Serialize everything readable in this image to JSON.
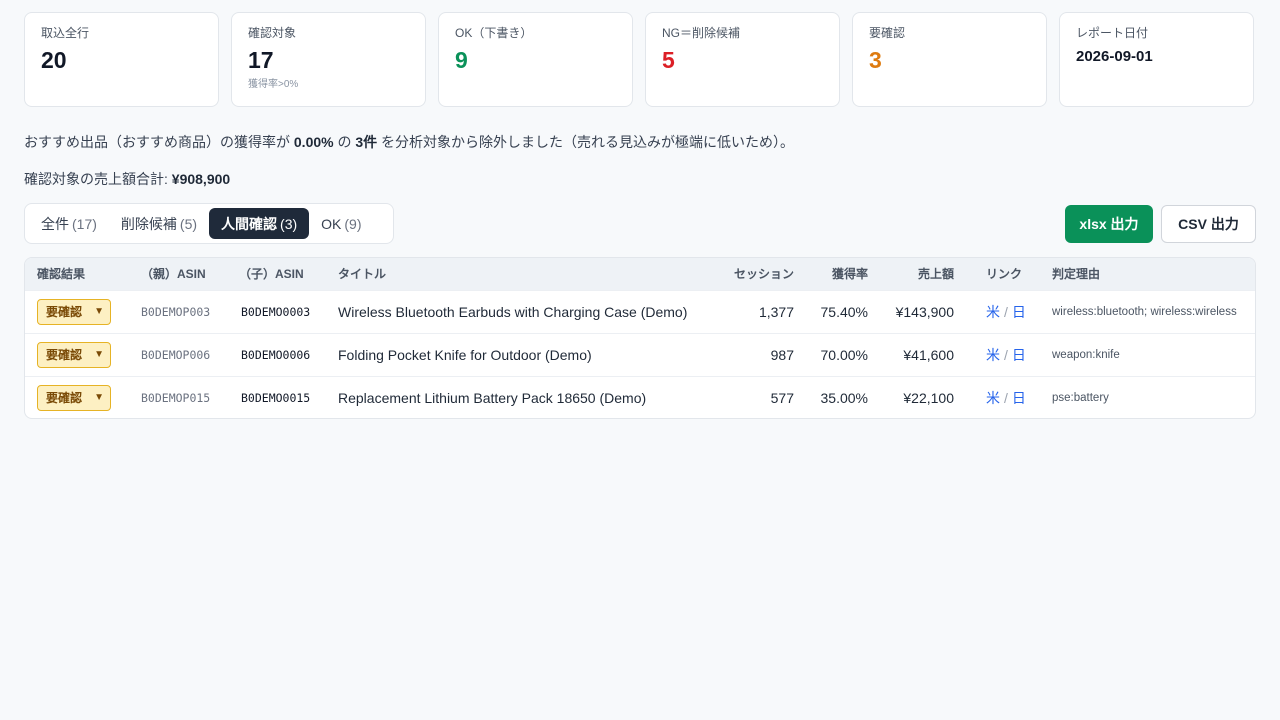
{
  "stats": [
    {
      "label": "取込全行",
      "value": "20",
      "sub": "",
      "color": "#111827"
    },
    {
      "label": "確認対象",
      "value": "17",
      "sub": "獲得率>0%",
      "color": "#111827"
    },
    {
      "label": "OK（下書き）",
      "value": "9",
      "sub": "",
      "color": "#0a9159"
    },
    {
      "label": "NG＝削除候補",
      "value": "5",
      "sub": "",
      "color": "#dc1f26"
    },
    {
      "label": "要確認",
      "value": "3",
      "sub": "",
      "color": "#de7b10"
    },
    {
      "label": "レポート日付",
      "value": "2026-09-01",
      "sub": "",
      "color": "#111827"
    }
  ],
  "summary": {
    "part1": "おすすめ出品（おすすめ商品）の獲得率が ",
    "rate": "0.00%",
    "part2": " の ",
    "count": "3件",
    "part3": " を分析対象から除外しました（売れる見込みが極端に低いため）。"
  },
  "total": {
    "label": "確認対象の売上額合計: ",
    "value": "¥908,900"
  },
  "tabs": [
    {
      "label": "全件",
      "count": "(17)",
      "active": false
    },
    {
      "label": "削除候補",
      "count": "(5)",
      "active": false
    },
    {
      "label": "人間確認",
      "count": "(3)",
      "active": true
    },
    {
      "label": "OK",
      "count": "(9)",
      "active": false
    }
  ],
  "buttons": {
    "xlsx": "xlsx 出力",
    "csv": "CSV 出力"
  },
  "table": {
    "headers": [
      "確認結果",
      "（親）ASIN",
      "（子）ASIN",
      "タイトル",
      "セッション",
      "獲得率",
      "売上額",
      "リンク",
      "判定理由"
    ],
    "rows": [
      {
        "status": "要確認",
        "parent_asin": "B0DEMOP003",
        "child_asin": "B0DEMO0003",
        "title": "Wireless Bluetooth Earbuds with Charging Case (Demo)",
        "sessions": "1,377",
        "rate": "75.40%",
        "sales": "¥143,900",
        "link_us": "米",
        "link_sep": "/",
        "link_jp": "日",
        "reason": "wireless:bluetooth; wireless:wireless"
      },
      {
        "status": "要確認",
        "parent_asin": "B0DEMOP006",
        "child_asin": "B0DEMO0006",
        "title": "Folding Pocket Knife for Outdoor (Demo)",
        "sessions": "987",
        "rate": "70.00%",
        "sales": "¥41,600",
        "link_us": "米",
        "link_sep": "/",
        "link_jp": "日",
        "reason": "weapon:knife"
      },
      {
        "status": "要確認",
        "parent_asin": "B0DEMOP015",
        "child_asin": "B0DEMO0015",
        "title": "Replacement Lithium Battery Pack 18650 (Demo)",
        "sessions": "577",
        "rate": "35.00%",
        "sales": "¥22,100",
        "link_us": "米",
        "link_sep": "/",
        "link_jp": "日",
        "reason": "pse:battery"
      }
    ]
  }
}
